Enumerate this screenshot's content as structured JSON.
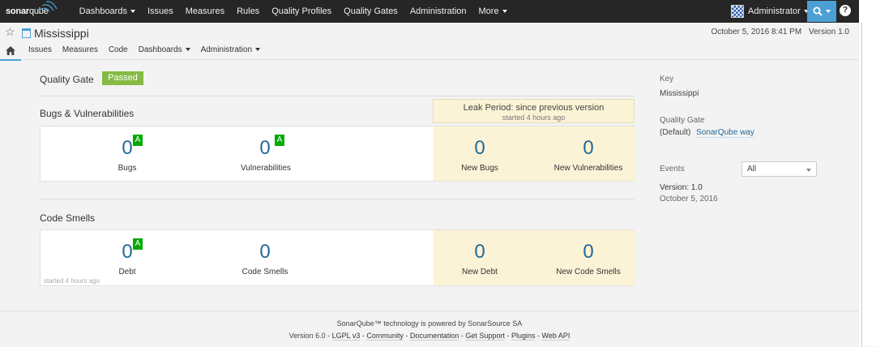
{
  "topnav": {
    "logo_bold": "sonar",
    "logo_light": "qube",
    "items": [
      {
        "label": "Dashboards",
        "dropdown": true
      },
      {
        "label": "Issues",
        "dropdown": false
      },
      {
        "label": "Measures",
        "dropdown": false
      },
      {
        "label": "Rules",
        "dropdown": false
      },
      {
        "label": "Quality Profiles",
        "dropdown": false
      },
      {
        "label": "Quality Gates",
        "dropdown": false
      },
      {
        "label": "Administration",
        "dropdown": false
      },
      {
        "label": "More",
        "dropdown": true
      }
    ],
    "user": "Administrator",
    "help": "?",
    "accent": "#4b9fd5"
  },
  "context": {
    "project": "Mississippi",
    "date": "October 5, 2016 8:41 PM",
    "version": "Version 1.0",
    "tabs": [
      {
        "label": "Issues"
      },
      {
        "label": "Measures"
      },
      {
        "label": "Code"
      },
      {
        "label": "Dashboards",
        "dropdown": true
      },
      {
        "label": "Administration",
        "dropdown": true
      }
    ]
  },
  "quality_gate": {
    "label": "Quality Gate",
    "status": "Passed",
    "color": "#85bb43"
  },
  "leak_period": {
    "title": "Leak Period: since previous version",
    "subtitle": "started 4 hours ago"
  },
  "bugs_section": {
    "title": "Bugs & Vulnerabilities",
    "bugs": {
      "value": "0",
      "label": "Bugs",
      "rating": "A"
    },
    "vulnerabilities": {
      "value": "0",
      "label": "Vulnerabilities",
      "rating": "A"
    },
    "new_bugs": {
      "value": "0",
      "label": "New Bugs"
    },
    "new_vulnerabilities": {
      "value": "0",
      "label": "New Vulnerabilities"
    }
  },
  "smells_section": {
    "title": "Code Smells",
    "debt": {
      "value": "0",
      "label": "Debt",
      "rating": "A"
    },
    "code_smells": {
      "value": "0",
      "label": "Code Smells"
    },
    "new_debt": {
      "value": "0",
      "label": "New Debt"
    },
    "new_code_smells": {
      "value": "0",
      "label": "New Code Smells"
    },
    "started_note": "started 4 hours ago"
  },
  "sidebar": {
    "key_label": "Key",
    "key_value": "Mississippi",
    "qg_label": "Quality Gate",
    "qg_default": "(Default)",
    "qg_link": "SonarQube way",
    "events_label": "Events",
    "events_filter": "All",
    "event_version": "Version: 1.0",
    "event_date": "October 5, 2016"
  },
  "footer": {
    "line1": "SonarQube™ technology is powered by SonarSource SA",
    "version": "Version 6.0",
    "links": [
      "LGPL v3",
      "Community",
      "Documentation",
      "Get Support",
      "Plugins",
      "Web API"
    ]
  }
}
